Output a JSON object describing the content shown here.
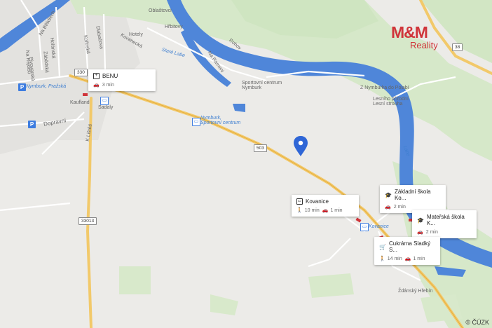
{
  "map": {
    "copyright": "© ČÚZK",
    "logo": {
      "brand": "M&M",
      "subtitle": "Reality"
    },
    "place_labels": [
      "Na Bělidlech",
      "Kolínská",
      "Dlabačova",
      "Hořánská",
      "Kovanecká",
      "Zábědská",
      "Na Rejdišti",
      "Pivovarská",
      "Oblaštovci",
      "Hřbitovy",
      "Hotely",
      "Staré Labe",
      "Na Rameni",
      "Kaufland",
      "Sadaly",
      "Dopravní",
      "K Lištěti",
      "Rohov",
      "Sportovní centrum Nymburk",
      "Z Nymburka do Polabí",
      "Lesního přírodní Lesní strouha",
      "Ždánský Hřebín",
      "Labe"
    ],
    "blue_labels": [
      "Nymburk, Pražská",
      "Nymburk, Sportovní centrum",
      "Kovanice"
    ],
    "road_shields": [
      "330",
      "503",
      "33013",
      "38"
    ],
    "pin_icon": "location-pin-icon"
  },
  "cards": {
    "benu": {
      "icon": "pharmacy-icon",
      "title": "BENU",
      "drive": "3 min"
    },
    "kovanice": {
      "icon": "bus-icon",
      "title": "Kovanice",
      "walk": "10 min",
      "drive": "1 min"
    },
    "zs": {
      "icon": "school-icon",
      "title": "Základní škola Ko...",
      "drive": "2 min"
    },
    "ms": {
      "icon": "school-icon",
      "title": "Mateřská škola K...",
      "drive": "2 min"
    },
    "shop": {
      "icon": "cart-icon",
      "title": "Cukrárna Sladký S...",
      "walk": "14 min",
      "drive": "1 min"
    }
  }
}
